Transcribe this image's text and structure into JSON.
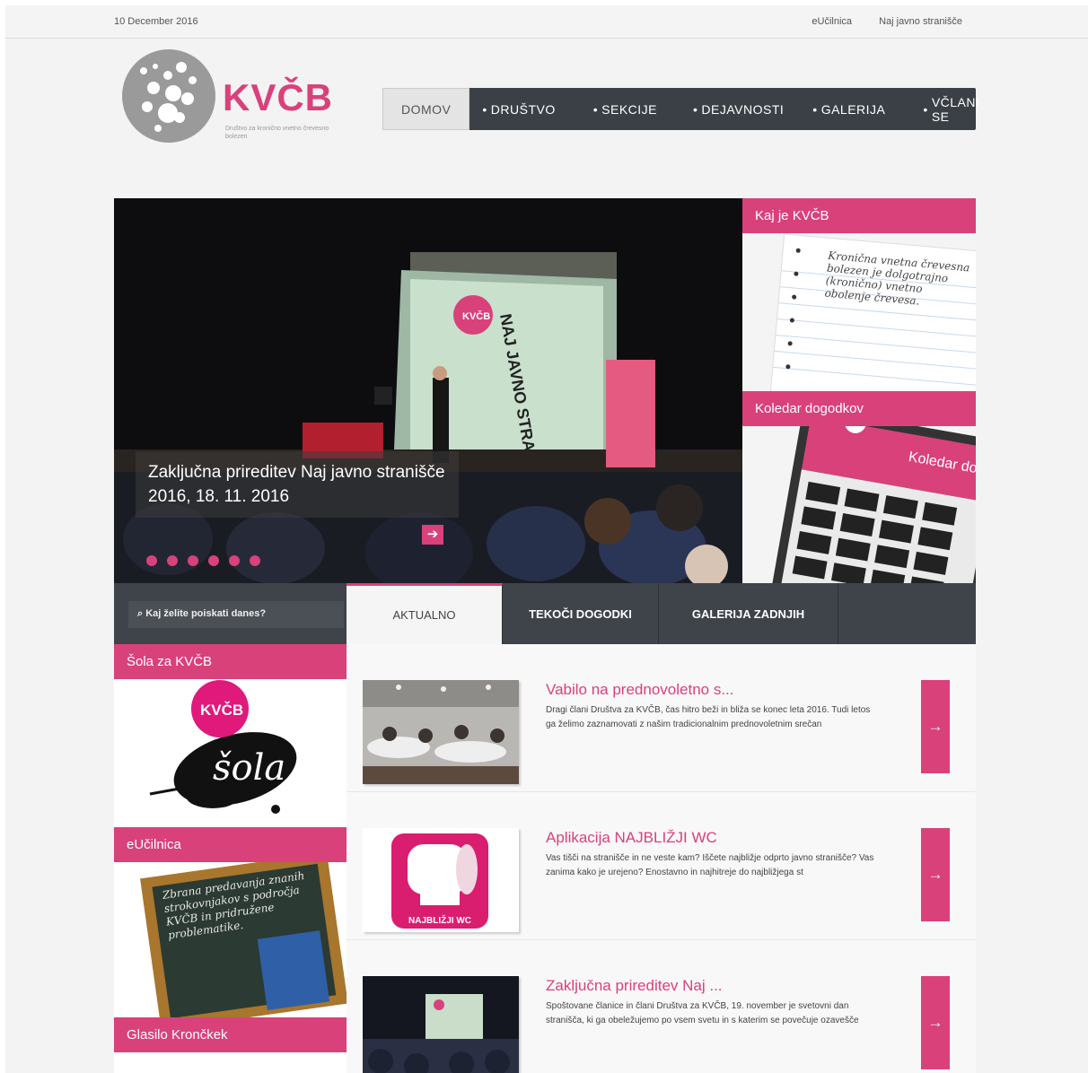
{
  "topbar": {
    "date": "10 December 2016",
    "links": [
      "eUčilnica",
      "Naj javno stranišče"
    ]
  },
  "logo": {
    "brand": "KVČB",
    "tagline": "Društvo za kronično vnetno črevesno bolezen"
  },
  "nav": {
    "items": [
      "DOMOV",
      "DRUŠTVO",
      "SEKCIJE",
      "DEJAVNOSTI",
      "GALERIJA",
      "VČLANI SE"
    ],
    "active_index": 0
  },
  "hero": {
    "caption": "Zaključna prireditev Naj javno stranišče 2016, 18. 11. 2016",
    "banner_text": "KVČB",
    "banner_text_2": "NAJ JAVNO STRANIŠČE",
    "go_icon": "arrow-right-icon",
    "slide_count": 6
  },
  "right": {
    "kaj_title": "Kaj je KVČB",
    "kaj_note": "Kronična vnetna črevesna bolezen je dolgotrajno (kronično) vnetno obolenje črevesa.",
    "koledar_title": "Koledar dogodkov",
    "koledar_note": "Koledar dogodkov"
  },
  "search": {
    "placeholder": "Kaj želite poiskati danes?",
    "icon": "search-icon"
  },
  "tabs": [
    "AKTUALNO",
    "TEKOČI DOGODKI",
    "GALERIJA ZADNJIH"
  ],
  "left": {
    "sola_title": "Šola za KVČB",
    "sola_badge": "KVČB",
    "sola_text": "šola",
    "eucilnica_title": "eUčilnica",
    "board_text": "Zbrana predavanja znanih strokovnjakov s področja KVČB in pridružene problematike.",
    "glasilo_title": "Glasilo Krončkek"
  },
  "news": [
    {
      "title": "Vabilo na prednovoletno s...",
      "desc": "Dragi člani Društva za KVČB, čas hitro beži in bliža se konec leta 2016. Tudi letos ga želimo zaznamovati z našim tradicionalnim prednovoletnim srečan",
      "thumb": "party-photo"
    },
    {
      "title": "Aplikacija NAJBLIŽJI WC",
      "desc": "Vas tišči na stranišče in ne veste kam? Iščete najbližje odprto javno stranišče? Vas zanima kako je urejeno? Enostavno in najhitreje do najbližjega st",
      "thumb": "toilet-roll-icon",
      "app_label": "NAJBLIŽJI WC"
    },
    {
      "title": "Zaključna prireditev Naj ...",
      "desc": "Spoštovane članice in člani Društva za KVČB, 19. november je svetovni dan stranišča, ki ga obeležujemo po vsem svetu in s katerim se povečuje ozavešče",
      "thumb": "stage-photo"
    }
  ],
  "colors": {
    "accent": "#d9417b",
    "nav_bg": "#3b4046",
    "page_bg": "#f3f3f3"
  }
}
